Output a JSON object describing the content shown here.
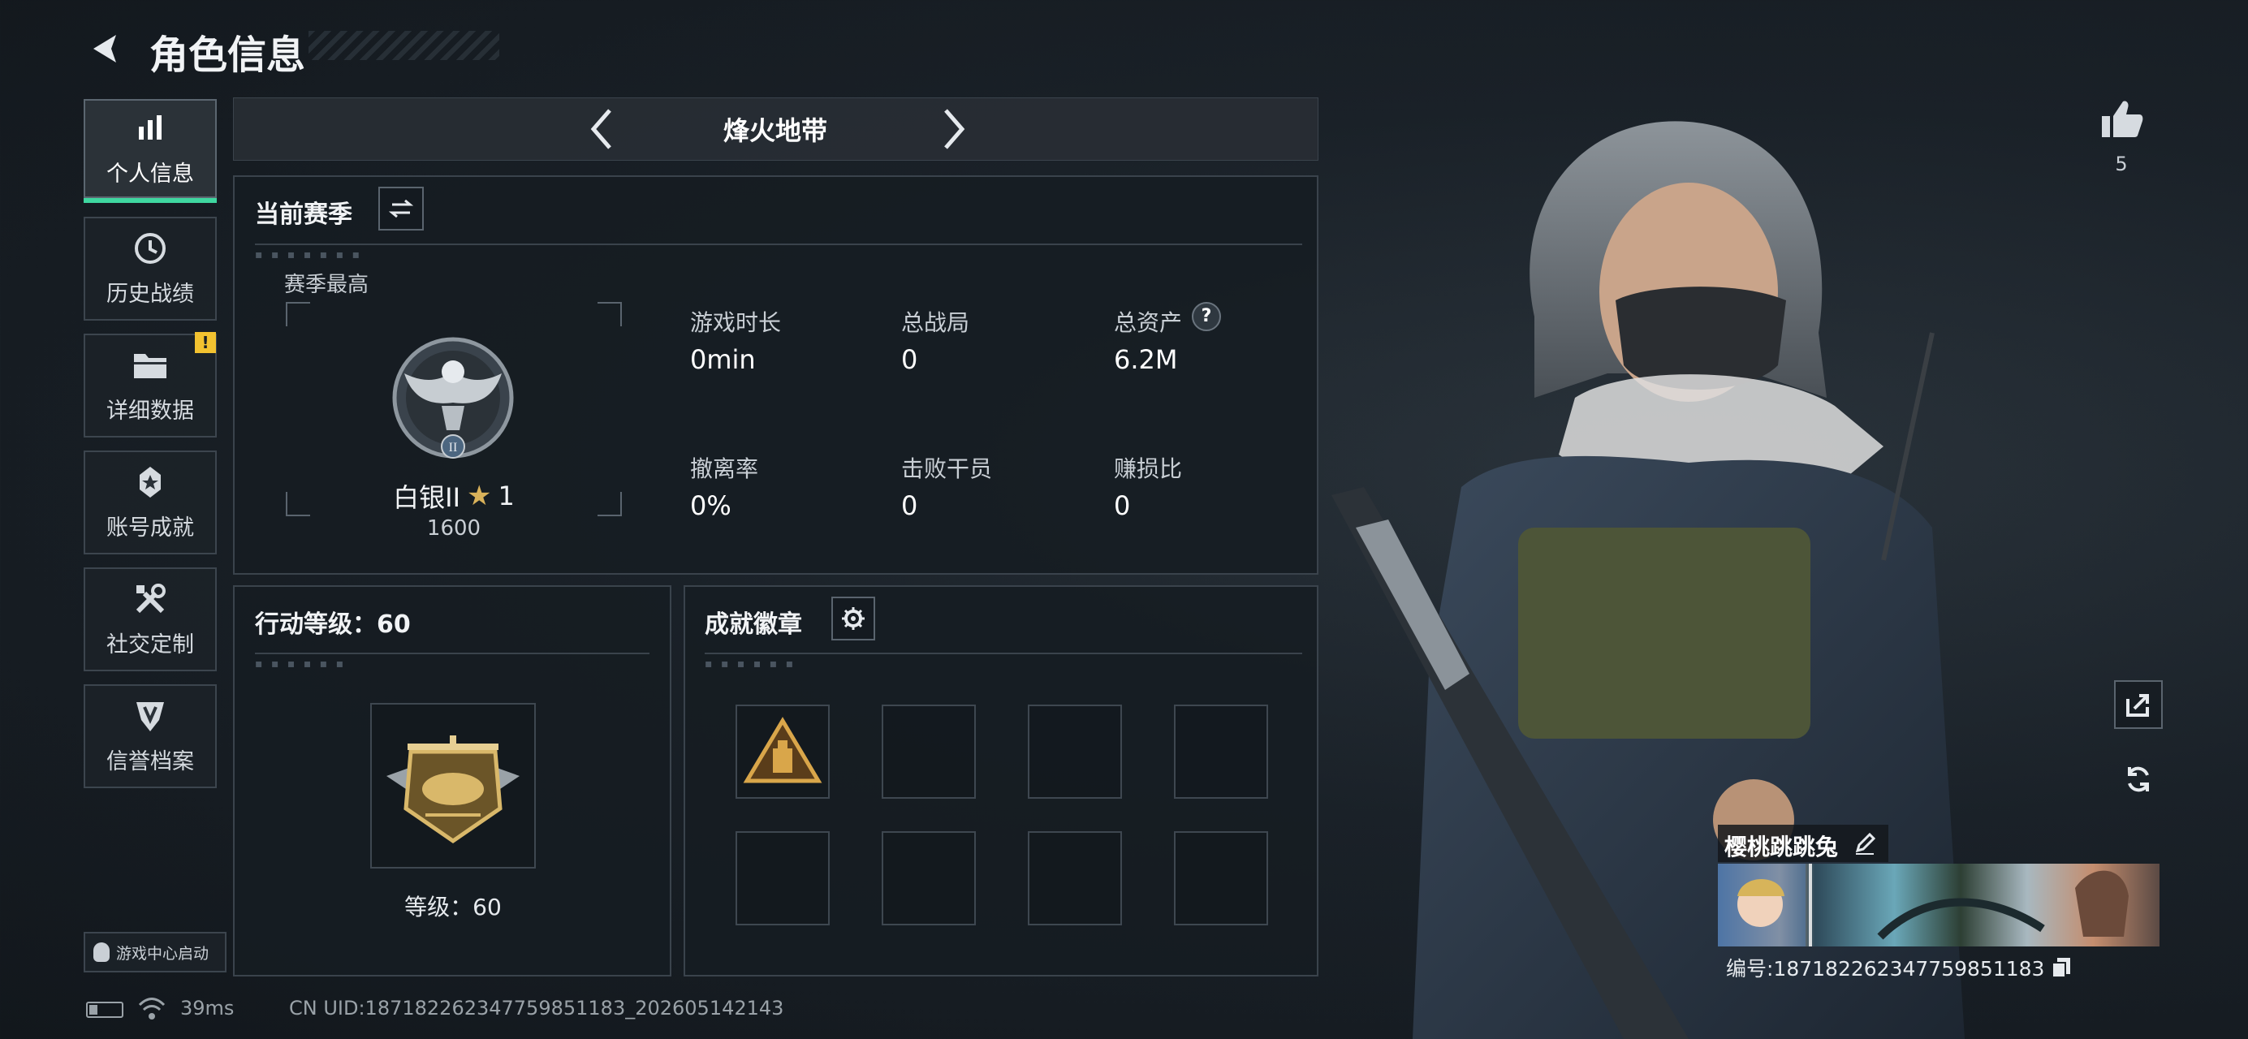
{
  "header": {
    "title": "角色信息"
  },
  "nav": {
    "items": [
      {
        "label": "个人信息",
        "icon": "bar-chart-icon",
        "active": true
      },
      {
        "label": "历史战绩",
        "icon": "history-icon"
      },
      {
        "label": "详细数据",
        "icon": "folder-icon",
        "badge": "!"
      },
      {
        "label": "账号成就",
        "icon": "medal-icon"
      },
      {
        "label": "社交定制",
        "icon": "tools-icon"
      },
      {
        "label": "信誉档案",
        "icon": "shield-icon"
      }
    ],
    "launch_label": "游戏中心启动"
  },
  "mode_selector": {
    "title": "烽火地带"
  },
  "season": {
    "title": "当前赛季",
    "best_label": "赛季最高",
    "rank_name": "白银II",
    "rank_stars": "1",
    "rank_points": "1600",
    "rank_numeral": "II",
    "stats": [
      {
        "label": "游戏时长",
        "value": "0min"
      },
      {
        "label": "总战局",
        "value": "0"
      },
      {
        "label": "总资产",
        "value": "6.2M",
        "help": "?"
      },
      {
        "label": "撤离率",
        "value": "0%"
      },
      {
        "label": "击败干员",
        "value": "0"
      },
      {
        "label": "赚损比",
        "value": "0"
      }
    ]
  },
  "action_level": {
    "title": "行动等级：60",
    "level_text": "等级：60"
  },
  "achievements": {
    "title": "成就徽章"
  },
  "profile": {
    "name": "樱桃跳跳兔",
    "id_text": "编号:1871822623477598511​83",
    "likes": "5"
  },
  "status_bar": {
    "ping": "39ms",
    "uid": "CN UID:1871822623477598511​83_202605142143"
  },
  "colors": {
    "accent_green": "#3fd7a0",
    "badge_yellow": "#f2c230",
    "text": "#e8ecef"
  }
}
